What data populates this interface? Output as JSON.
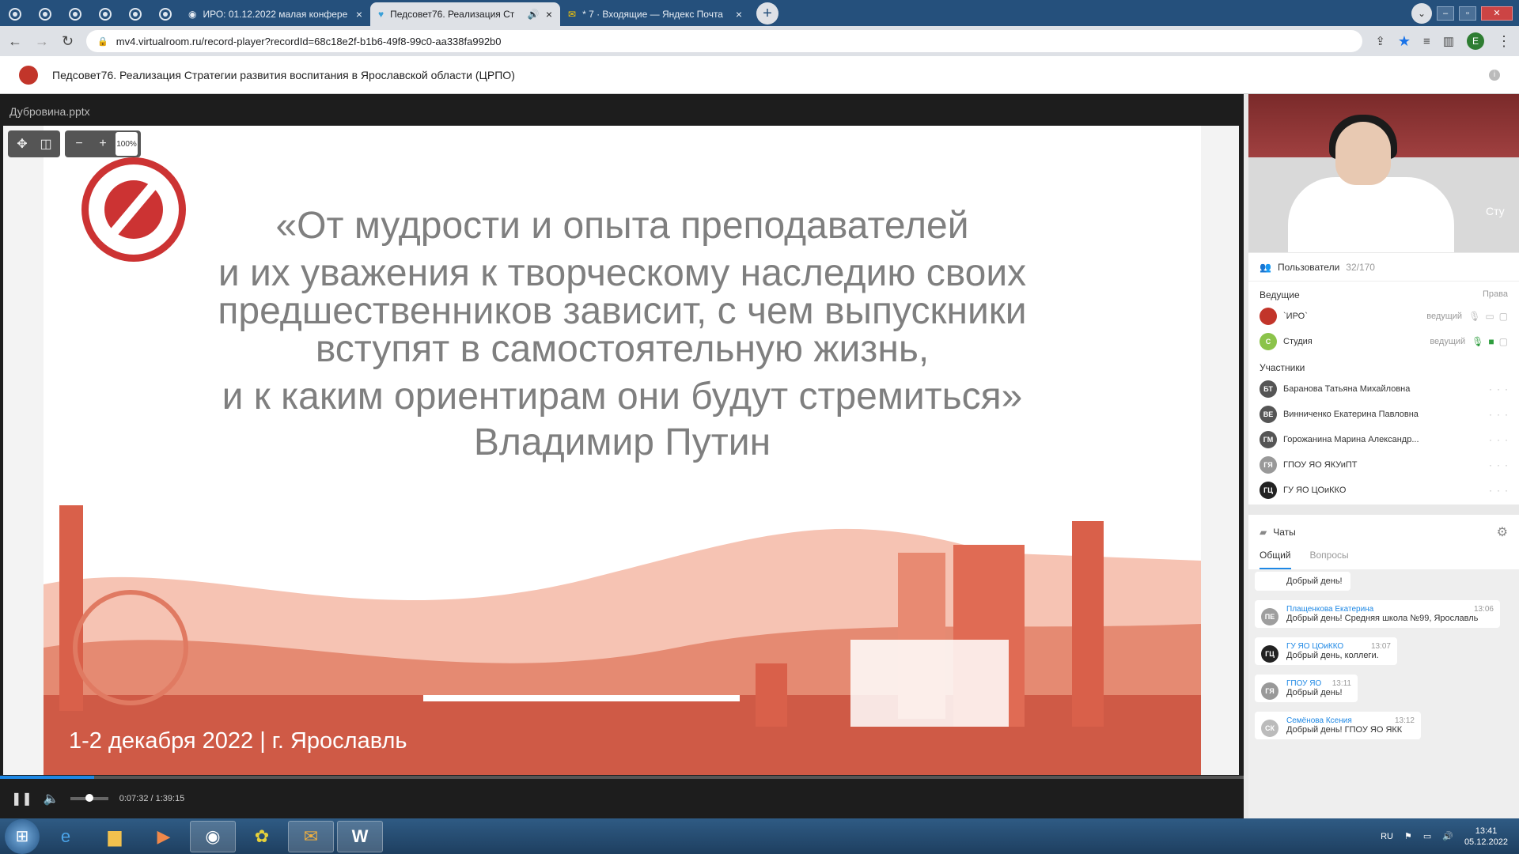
{
  "browser": {
    "pinned_tabs": [
      "",
      "",
      "",
      "",
      "",
      ""
    ],
    "tabs": [
      {
        "title": "ИРО: 01.12.2022 малая конфере",
        "close": "×"
      },
      {
        "title": "Педсовет76. Реализация Ст",
        "close": "×",
        "active": true
      },
      {
        "title": "* 7 · Входящие — Яндекс Почта",
        "close": "×"
      }
    ],
    "new_tab": "+",
    "url": "mv4.virtualroom.ru/record-player?recordId=68c18e2f-b1b6-49f8-99c0-aa338fa992b0",
    "profile_letter": "E"
  },
  "app": {
    "title": "Педсовет76. Реализация Стратегии развития воспитания в Ярославской области (ЦРПО)"
  },
  "presentation": {
    "file_name": "Дубровина.pptx",
    "zoom": "100%",
    "quote_lines": [
      "«От мудрости и опыта преподавателей",
      "и их уважения к творческому наследию своих",
      "предшественников зависит, с чем выпускники",
      "вступят в самостоятельную жизнь,",
      "и к каким ориентирам они будут стремиться»",
      "Владимир Путин"
    ],
    "footer": "1-2 декабря 2022   | г. Ярославль"
  },
  "player": {
    "time": "0:07:32 / 1:39:15",
    "progress": 0.076,
    "volume": 0.5,
    "lang": "RU"
  },
  "video": {
    "label": "Сту"
  },
  "users": {
    "header": "Пользователи",
    "count": "32/170",
    "hosts_label": "Ведущие",
    "rights_label": "Права",
    "hosts": [
      {
        "initials": "",
        "name": "`ИРО`",
        "role": "ведущий"
      },
      {
        "initials": "С",
        "name": "Студия",
        "role": "ведущий"
      }
    ],
    "participants_label": "Участники",
    "participants": [
      {
        "initials": "БТ",
        "name": "Баранова Татьяна Михайловна"
      },
      {
        "initials": "ВЕ",
        "name": "Винниченко Екатерина Павловна"
      },
      {
        "initials": "ГМ",
        "name": "Горожанина Марина Александр..."
      },
      {
        "initials": "ГЯ",
        "name": "ГПОУ ЯО ЯКУиПТ"
      },
      {
        "initials": "ГЦ",
        "name": "ГУ ЯО ЦОиККО"
      }
    ]
  },
  "chat": {
    "header": "Чаты",
    "tabs": [
      "Общий",
      "Вопросы"
    ],
    "partial": "Добрый день!",
    "messages": [
      {
        "initials": "ПЕ",
        "name": "Плащенкова Екатерина",
        "time": "13:06",
        "text": "Добрый день! Средняя школа №99, Ярославль"
      },
      {
        "initials": "ГЦ",
        "name": "ГУ ЯО ЦОиККО",
        "time": "13:07",
        "text": "Добрый день, коллеги."
      },
      {
        "initials": "ГЯ",
        "name": "ГПОУ ЯО",
        "time": "13:11",
        "text": "Добрый день!"
      },
      {
        "initials": "СК",
        "name": "Семёнова Ксения",
        "time": "13:12",
        "text": "Добрый день! ГПОУ ЯО ЯКК"
      }
    ]
  },
  "taskbar": {
    "lang": "RU",
    "time": "13:41",
    "date": "05.12.2022"
  },
  "colors": {
    "accent": "#1e88e5",
    "brand": "#c2352a",
    "slide_banner": "#d9604a"
  }
}
